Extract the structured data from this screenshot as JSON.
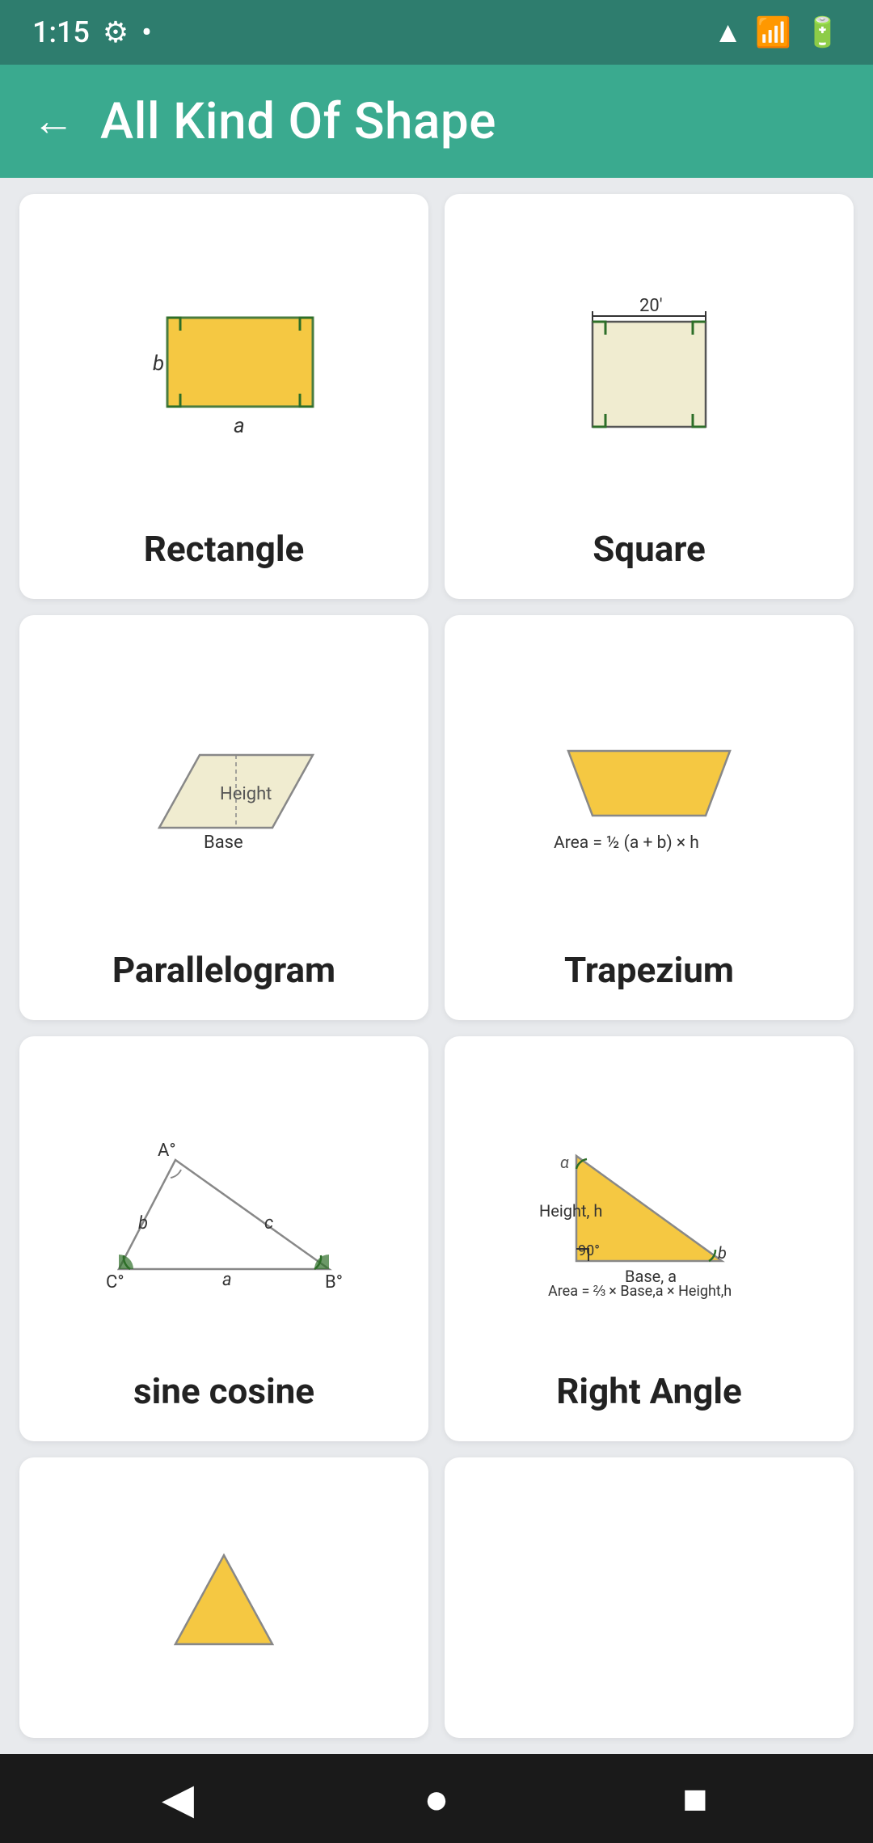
{
  "status": {
    "time": "1:15",
    "icons": [
      "settings",
      "dot",
      "wifi",
      "signal",
      "battery"
    ]
  },
  "header": {
    "title": "All Kind Of Shape",
    "back_label": "←"
  },
  "cards": [
    {
      "id": "rectangle",
      "label": "Rectangle"
    },
    {
      "id": "square",
      "label": "Square"
    },
    {
      "id": "parallelogram",
      "label": "Parallelogram"
    },
    {
      "id": "trapezium",
      "label": "Trapezium"
    },
    {
      "id": "sine-cosine",
      "label": "sine cosine"
    },
    {
      "id": "right-angle",
      "label": "Right Angle"
    },
    {
      "id": "card7",
      "label": ""
    },
    {
      "id": "card8",
      "label": ""
    }
  ],
  "nav": {
    "back": "◀",
    "home": "●",
    "recents": "■"
  }
}
